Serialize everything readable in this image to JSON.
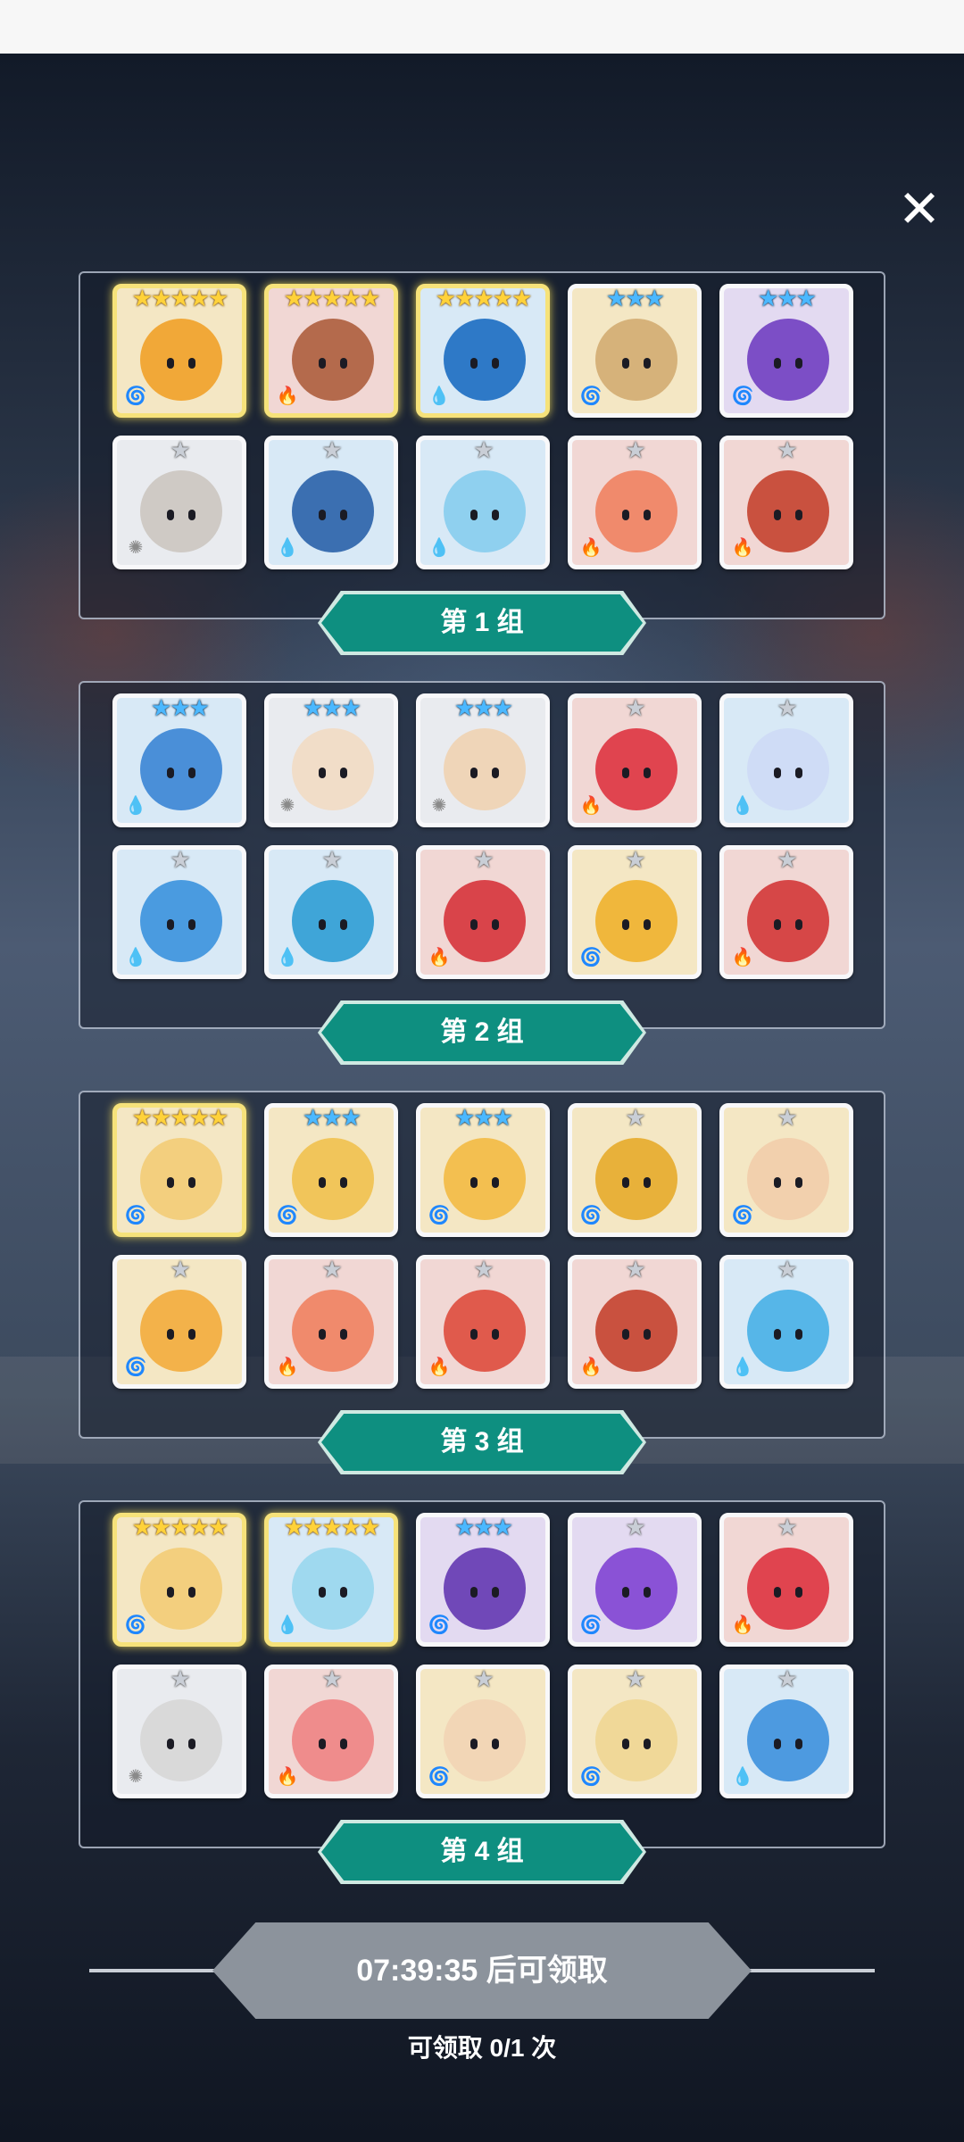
{
  "close": {
    "icon": "close-icon",
    "glyph": "✕"
  },
  "groups": [
    {
      "label": "第 1 组",
      "heroes": [
        {
          "stars": 5,
          "tier": "gold",
          "element": "wind",
          "color": "#f1a838"
        },
        {
          "stars": 5,
          "tier": "gold",
          "element": "fire",
          "color": "#b46a4c"
        },
        {
          "stars": 5,
          "tier": "gold",
          "element": "water",
          "color": "#2e79c7"
        },
        {
          "stars": 3,
          "tier": "blue",
          "element": "wind",
          "color": "#d6b27a"
        },
        {
          "stars": 3,
          "tier": "blue",
          "element": "dark",
          "color": "#7c4ec6"
        },
        {
          "stars": 1,
          "tier": "gray",
          "element": "light",
          "color": "#cfcac5"
        },
        {
          "stars": 1,
          "tier": "gray",
          "element": "water",
          "color": "#3b6fb1"
        },
        {
          "stars": 1,
          "tier": "gray",
          "element": "water",
          "color": "#8fd0ef"
        },
        {
          "stars": 1,
          "tier": "gray",
          "element": "fire",
          "color": "#f08a6c"
        },
        {
          "stars": 1,
          "tier": "gray",
          "element": "fire",
          "color": "#c9513f"
        }
      ]
    },
    {
      "label": "第 2 组",
      "heroes": [
        {
          "stars": 3,
          "tier": "blue",
          "element": "water",
          "color": "#4a8fd8"
        },
        {
          "stars": 3,
          "tier": "blue",
          "element": "light",
          "color": "#f1ddc8"
        },
        {
          "stars": 3,
          "tier": "blue",
          "element": "light",
          "color": "#efd5b8"
        },
        {
          "stars": 1,
          "tier": "gray",
          "element": "fire",
          "color": "#e0444f"
        },
        {
          "stars": 1,
          "tier": "gray",
          "element": "water",
          "color": "#cfdcf6"
        },
        {
          "stars": 1,
          "tier": "gray",
          "element": "water",
          "color": "#4a9be0"
        },
        {
          "stars": 1,
          "tier": "gray",
          "element": "water",
          "color": "#3fa5d8"
        },
        {
          "stars": 1,
          "tier": "gray",
          "element": "fire",
          "color": "#d9444a"
        },
        {
          "stars": 1,
          "tier": "gray",
          "element": "wind",
          "color": "#f0b73c"
        },
        {
          "stars": 1,
          "tier": "gray",
          "element": "fire",
          "color": "#d64747"
        }
      ]
    },
    {
      "label": "第 3 组",
      "heroes": [
        {
          "stars": 5,
          "tier": "gold",
          "element": "wind",
          "color": "#f3cf7e"
        },
        {
          "stars": 3,
          "tier": "blue",
          "element": "wind",
          "color": "#f1c55a"
        },
        {
          "stars": 3,
          "tier": "blue",
          "element": "wind",
          "color": "#f3bf50"
        },
        {
          "stars": 1,
          "tier": "gray",
          "element": "wind",
          "color": "#e8b13a"
        },
        {
          "stars": 1,
          "tier": "gray",
          "element": "wind",
          "color": "#f2d0ad"
        },
        {
          "stars": 1,
          "tier": "gray",
          "element": "wind",
          "color": "#f3b24a"
        },
        {
          "stars": 1,
          "tier": "gray",
          "element": "fire",
          "color": "#f08a6c"
        },
        {
          "stars": 1,
          "tier": "gray",
          "element": "fire",
          "color": "#e05a4c"
        },
        {
          "stars": 1,
          "tier": "gray",
          "element": "fire",
          "color": "#c9513f"
        },
        {
          "stars": 1,
          "tier": "gray",
          "element": "water",
          "color": "#56b6e8"
        }
      ]
    },
    {
      "label": "第 4 组",
      "heroes": [
        {
          "stars": 5,
          "tier": "gold",
          "element": "wind",
          "color": "#f3cf7e"
        },
        {
          "stars": 5,
          "tier": "gold",
          "element": "water",
          "color": "#9fd9ef"
        },
        {
          "stars": 3,
          "tier": "blue",
          "element": "dark",
          "color": "#7048b8"
        },
        {
          "stars": 1,
          "tier": "gray",
          "element": "dark",
          "color": "#8a52d6"
        },
        {
          "stars": 1,
          "tier": "gray",
          "element": "fire",
          "color": "#e0444f"
        },
        {
          "stars": 1,
          "tier": "gray",
          "element": "light",
          "color": "#d9d9d9"
        },
        {
          "stars": 1,
          "tier": "gray",
          "element": "fire",
          "color": "#ef8c8c"
        },
        {
          "stars": 1,
          "tier": "gray",
          "element": "wind",
          "color": "#f2d6b6"
        },
        {
          "stars": 1,
          "tier": "gray",
          "element": "wind",
          "color": "#f0d898"
        },
        {
          "stars": 1,
          "tier": "gray",
          "element": "water",
          "color": "#4d9ae0"
        }
      ]
    }
  ],
  "claim": {
    "label": "07:39:35 后可领取",
    "count_text": "可领取 0/1 次"
  },
  "colors": {
    "label_bg": "#0e8f80",
    "claim_bg": "#8c939c",
    "gold": "#ffd23a",
    "blue": "#4bb8ff"
  }
}
